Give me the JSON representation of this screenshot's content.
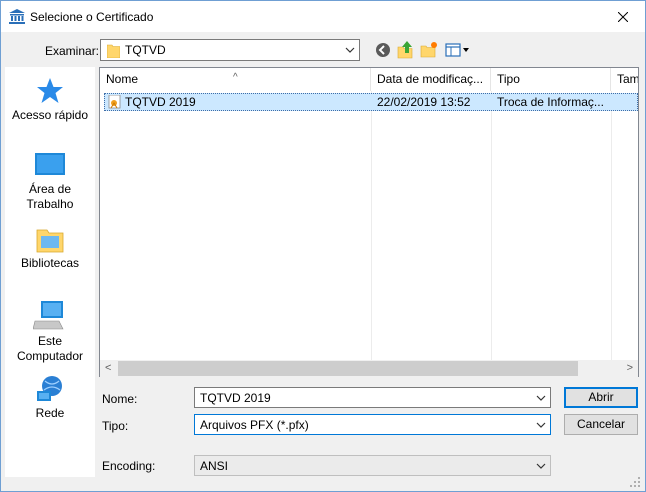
{
  "window": {
    "title": "Selecione o Certificado"
  },
  "toolbar": {
    "look_in_label": "Examinar:",
    "current_folder": "TQTVD"
  },
  "places": [
    {
      "label": "Acesso rápido",
      "icon": "star-icon"
    },
    {
      "label": "Área de Trabalho",
      "icon": "desktop-icon"
    },
    {
      "label": "Bibliotecas",
      "icon": "libraries-icon"
    },
    {
      "label": "Este Computador",
      "icon": "computer-icon"
    },
    {
      "label": "Rede",
      "icon": "network-icon"
    }
  ],
  "file_list": {
    "columns": [
      "Nome",
      "Data de modificaç...",
      "Tipo",
      "Tam"
    ],
    "rows": [
      {
        "name": "TQTVD 2019",
        "modified": "22/02/2019 13:52",
        "type": "Troca de Informaç..."
      }
    ]
  },
  "form": {
    "name_label": "Nome:",
    "name_value": "TQTVD 2019",
    "type_label": "Tipo:",
    "type_value": "Arquivos PFX (*.pfx)",
    "encoding_label": "Encoding:",
    "encoding_value": "ANSI"
  },
  "buttons": {
    "open": "Abrir",
    "cancel": "Cancelar"
  },
  "colors": {
    "selection": "#cce8ff",
    "accent": "#0078d7",
    "folder": "#ffd66b"
  }
}
